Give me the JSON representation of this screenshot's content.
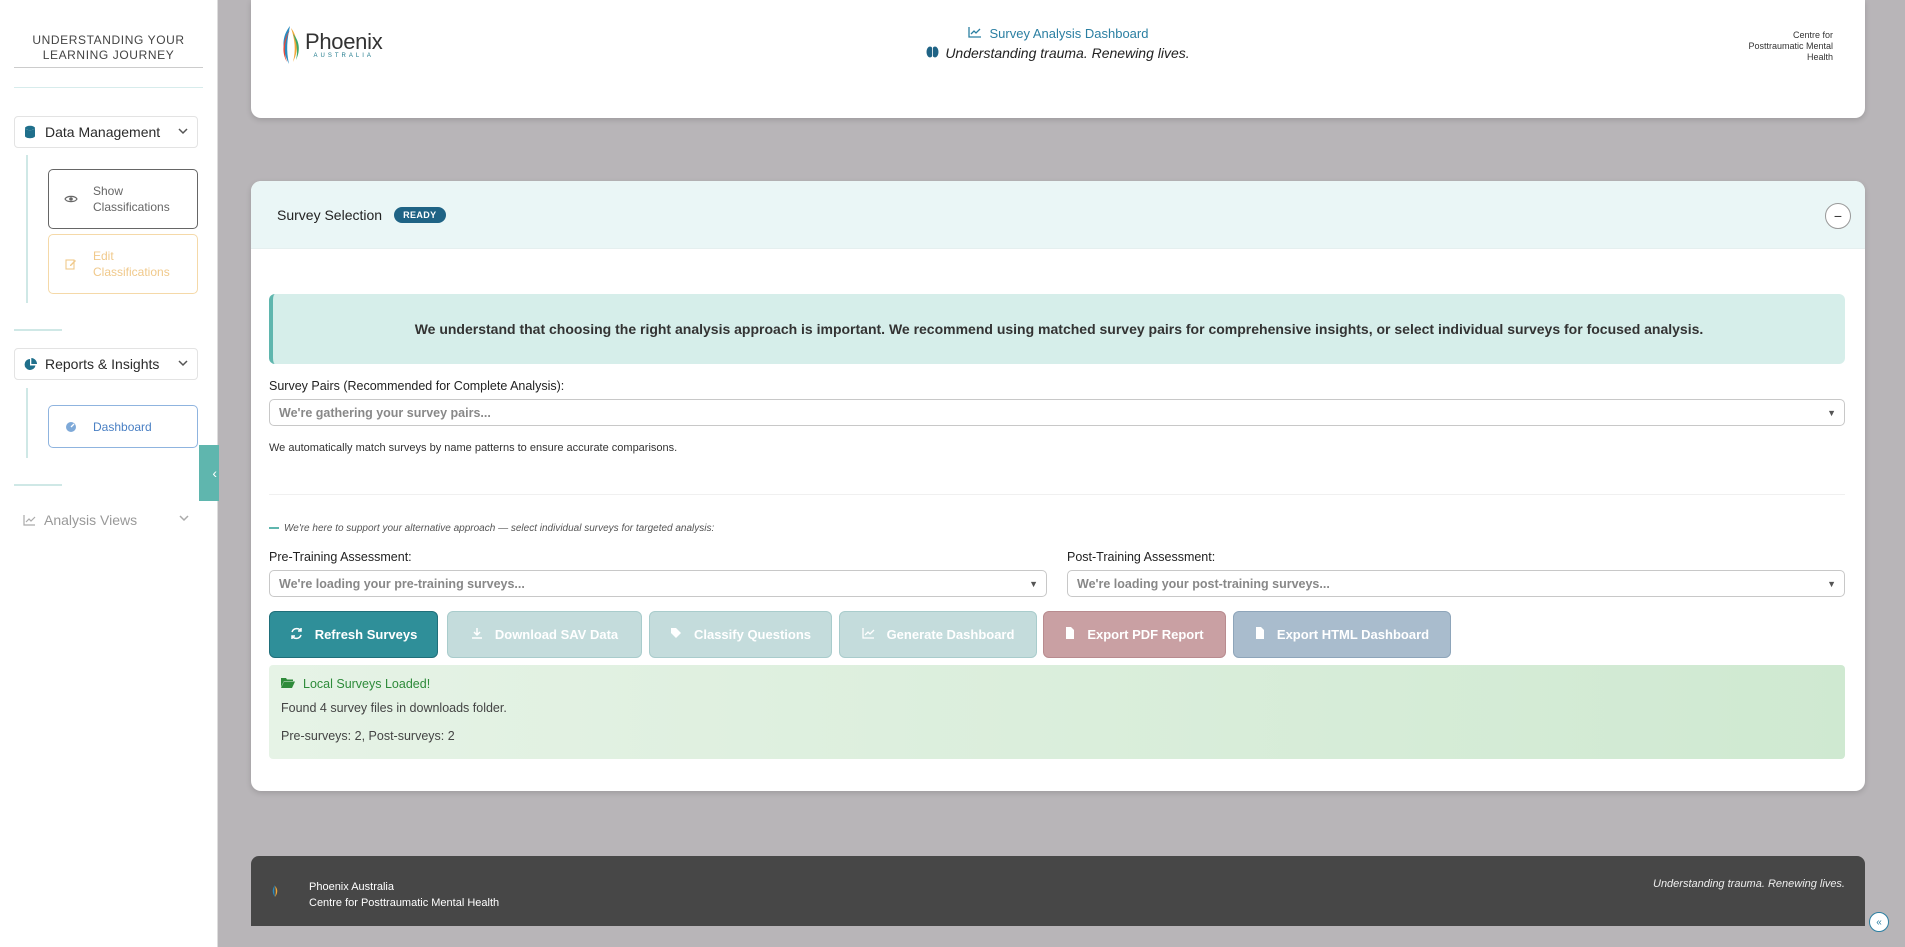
{
  "sidebar": {
    "title_line1": "UNDERSTANDING YOUR",
    "title_line2": "LEARNING JOURNEY",
    "sections": [
      {
        "label": "Data Management",
        "icon": "database-icon"
      },
      {
        "label": "Reports & Insights",
        "icon": "pie-chart-icon"
      },
      {
        "label": "Analysis Views",
        "icon": "line-chart-icon"
      }
    ],
    "buttons": {
      "show_line1": "Show",
      "show_line2": "Classifications",
      "edit_line1": "Edit",
      "edit_line2": "Classifications",
      "dashboard": "Dashboard"
    }
  },
  "header": {
    "logo_name": "Phoenix",
    "logo_sub": "AUSTRALIA",
    "dashboard_title": "Survey Analysis Dashboard",
    "tagline": "Understanding trauma. Renewing lives.",
    "right_line1": "Centre for",
    "right_line2": "Posttraumatic Mental",
    "right_line3": "Health"
  },
  "selection": {
    "title": "Survey Selection",
    "badge": "READY",
    "collapse_symbol": "−",
    "info": "We understand that choosing the right analysis approach is important. We recommend using matched survey pairs for comprehensive insights, or select individual surveys for focused analysis.",
    "pairs_label": "Survey Pairs (Recommended for Complete Analysis):",
    "pairs_placeholder": "We're gathering your survey pairs...",
    "pairs_note": "We automatically match surveys by name patterns to ensure accurate comparisons.",
    "alt_text": "We're here to support your alternative approach — select individual surveys for targeted analysis:",
    "pre_label": "Pre-Training Assessment:",
    "pre_placeholder": "We're loading your pre-training surveys...",
    "post_label": "Post-Training Assessment:",
    "post_placeholder": "We're loading your post-training surveys..."
  },
  "actions": {
    "refresh": "Refresh Surveys",
    "download": "Download SAV Data",
    "classify": "Classify Questions",
    "generate": "Generate Dashboard",
    "export_pdf": "Export PDF Report",
    "export_html": "Export HTML Dashboard"
  },
  "status": {
    "heading": "Local Surveys Loaded!",
    "line1": "Found 4 survey files in downloads folder.",
    "line2": "Pre-surveys: 2, Post-surveys: 2"
  },
  "footer": {
    "org": "Phoenix Australia",
    "org_sub": "Centre for Posttraumatic Mental Health",
    "tagline": "Understanding trauma. Renewing lives."
  },
  "colors": {
    "accent_teal": "#5fb6ae",
    "brand_blue": "#1f6385",
    "pdf_red": "#c9a0a3",
    "success_green": "#2e8b3a"
  }
}
